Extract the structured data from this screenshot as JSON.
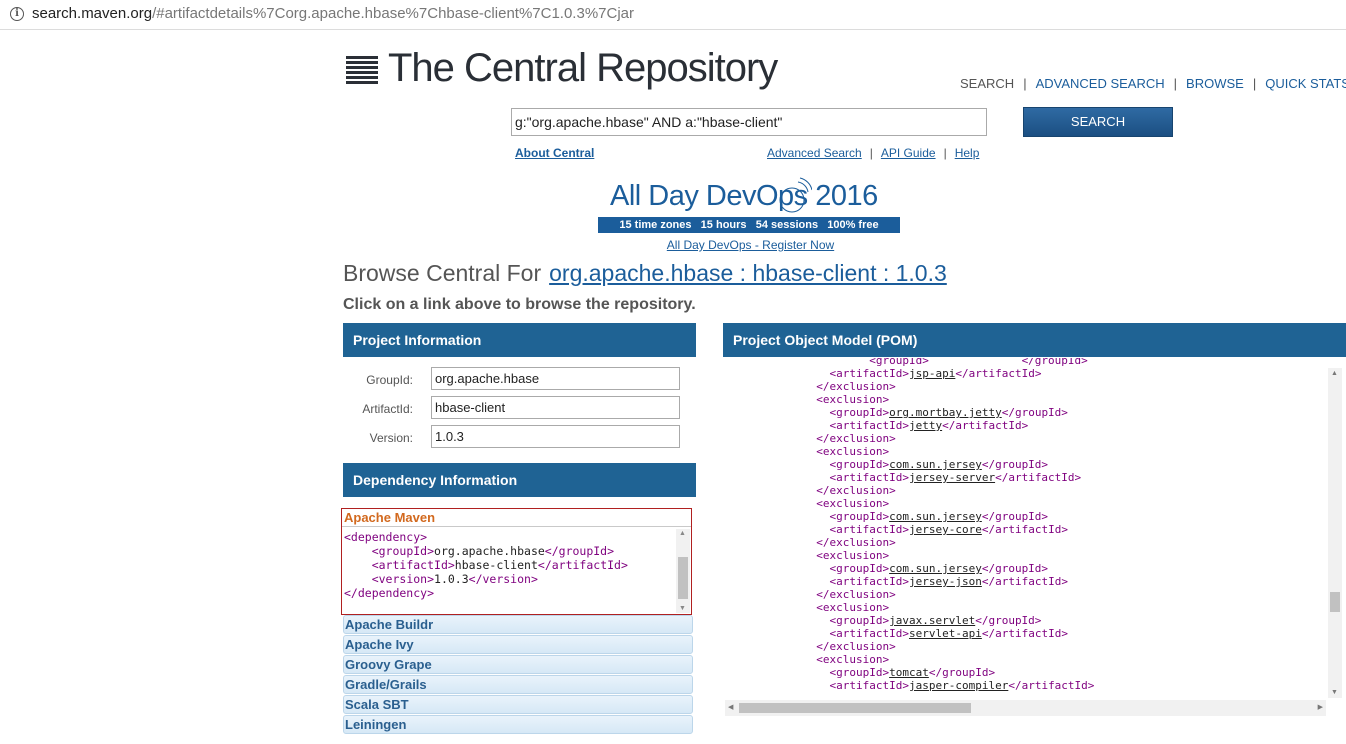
{
  "browser": {
    "url_host": "search.maven.org",
    "url_rest": "/#artifactdetails%7Corg.apache.hbase%7Chbase-client%7C1.0.3%7Cjar"
  },
  "header": {
    "site_title": "The Central Repository",
    "nav": [
      "SEARCH",
      "ADVANCED SEARCH",
      "BROWSE",
      "QUICK STATS"
    ],
    "search_value": "g:\"org.apache.hbase\" AND a:\"hbase-client\"",
    "search_button": "SEARCH",
    "about_link": "About Central",
    "sublinks": [
      "Advanced Search",
      "API Guide",
      "Help"
    ]
  },
  "banner": {
    "title": "All Day DevOps 2016",
    "strip": "15 time zones   15 hours   54 sessions   100% free",
    "link": "All Day DevOps - Register Now"
  },
  "browse": {
    "prefix": "Browse Central For",
    "coordinate": "org.apache.hbase : hbase-client : 1.0.3",
    "hint": "Click on a link above to browse the repository."
  },
  "project_info": {
    "heading": "Project Information",
    "groupid_label": "GroupId:",
    "groupid_value": "org.apache.hbase",
    "artifactid_label": "ArtifactId:",
    "artifactid_value": "hbase-client",
    "version_label": "Version:",
    "version_value": "1.0.3"
  },
  "dependency_info": {
    "heading": "Dependency Information",
    "active_tool": "Apache Maven",
    "tools": [
      "Apache Buildr",
      "Apache Ivy",
      "Groovy Grape",
      "Gradle/Grails",
      "Scala SBT",
      "Leiningen"
    ],
    "group_id": "org.apache.hbase",
    "artifact_id": "hbase-client",
    "version": "1.0.3"
  },
  "pom": {
    "heading": "Project Object Model (POM)",
    "exclusions": [
      {
        "groupId": "org.mortbay.jetty",
        "artifactId": "jetty"
      },
      {
        "groupId": "com.sun.jersey",
        "artifactId": "jersey-server"
      },
      {
        "groupId": "com.sun.jersey",
        "artifactId": "jersey-core"
      },
      {
        "groupId": "com.sun.jersey",
        "artifactId": "jersey-json"
      },
      {
        "groupId": "javax.servlet",
        "artifactId": "servlet-api"
      },
      {
        "groupId": "tomcat",
        "artifactId": "jasper-compiler"
      }
    ],
    "first_artifact": "jsp-api"
  },
  "colors": {
    "brand_blue": "#1f6394",
    "link_blue": "#1b5d9b",
    "maven_orange": "#d2691e"
  }
}
